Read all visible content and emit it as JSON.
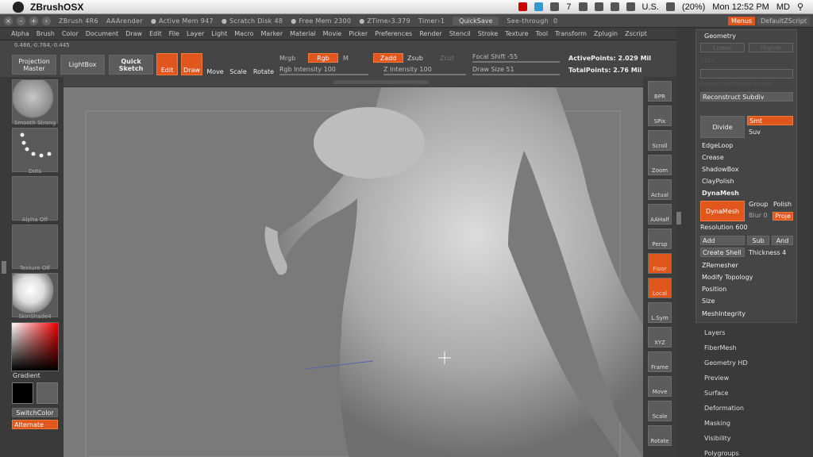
{
  "macbar": {
    "app_name": "ZBrushOSX",
    "adobe_count": "7",
    "battery": "(20%)",
    "clock": "Mon 12:52 PM",
    "user": "MD",
    "lang": "U.S."
  },
  "titlebar": {
    "version": "ZBrush 4R6",
    "render": "AAArender",
    "active_mem": "● Active Mem 947",
    "scratch": "● Scratch Disk 48",
    "free_mem": "● Free Mem 2300",
    "ztime": "● ZTime›3.379",
    "timer": "Timer›1",
    "quicksave": "QuickSave",
    "seethrough": "See-through",
    "seethrough_val": "0",
    "menus": "Menus",
    "default_zscript": "DefaultZScript"
  },
  "menu": [
    "Alpha",
    "Brush",
    "Color",
    "Document",
    "Draw",
    "Edit",
    "File",
    "Layer",
    "Light",
    "Macro",
    "Marker",
    "Material",
    "Movie",
    "Picker",
    "Preferences",
    "Render",
    "Stencil",
    "Stroke",
    "Texture",
    "Tool",
    "Transform",
    "Zplugin",
    "Zscript"
  ],
  "toolbar": {
    "coords": "0.466,-0.764,-0.445",
    "projection": "Projection\nMaster",
    "lightbox": "LightBox",
    "quicksketch": "Quick\nSketch",
    "edit": "Edit",
    "draw": "Draw",
    "move": "Move",
    "scale": "Scale",
    "rotate": "Rotate",
    "mrgb": "Mrgb",
    "rgb": "Rgb",
    "m": "M",
    "zadd": "Zadd",
    "zsub": "Zsub",
    "zcut": "Zcut",
    "rgb_intensity": "Rgb Intensity 100",
    "z_intensity": "Z Intensity 100",
    "focal_shift": "Focal Shift -55",
    "draw_size": "Draw Size 51",
    "active_points": "ActivePoints: 2.029 Mil",
    "total_points": "TotalPoints: 2.76 Mil"
  },
  "left": {
    "brush_label": "Smooth Strong",
    "stroke_label": "Dots",
    "alpha_label": "Alpha Off",
    "texture_label": "Texture Off",
    "material_label": "SkinShade4",
    "gradient": "Gradient",
    "switch_color": "SwitchColor",
    "alternate": "Alternate"
  },
  "right_tools": [
    "BPR",
    "SPix",
    "Scroll",
    "Zoom",
    "Actual",
    "AAHalf",
    "Persp",
    "Floor",
    "Local",
    "L.Sym",
    "XYZ",
    "Frame",
    "Move",
    "Scale",
    "Rotate"
  ],
  "right_panel": {
    "geometry": "Geometry",
    "sdiv": "SDiv",
    "lower": "Lower",
    "higher": "Higher",
    "freeze": "Freeze SubDivision Levels",
    "reconstruct": "Reconstruct Subdiv",
    "divide": "Divide",
    "smt": "Smt",
    "suv": "Suv",
    "edgeloop": "EdgeLoop",
    "crease": "Crease",
    "shadowbox": "ShadowBox",
    "claypolish": "ClayPolish",
    "dynamesh_head": "DynaMesh",
    "dynamesh_btn": "DynaMesh",
    "group": "Group",
    "polish": "Polish",
    "blur": "Blur 0",
    "project": "Proje",
    "resolution": "Resolution 600",
    "add": "Add",
    "sub": "Sub",
    "and": "And",
    "create_shell": "Create Shell",
    "thickness": "Thickness 4",
    "zremesher": "ZRemesher",
    "modify_topology": "Modify Topology",
    "position": "Position",
    "size": "Size",
    "meshintegrity": "MeshIntegrity",
    "sections": [
      "Layers",
      "FiberMesh",
      "Geometry HD",
      "Preview",
      "Surface",
      "Deformation",
      "Masking",
      "Visibility",
      "Polygroups"
    ]
  },
  "colors": {
    "accent": "#e0561c",
    "bg": "#3a3a3a",
    "viewport": "#7a7a7a"
  }
}
